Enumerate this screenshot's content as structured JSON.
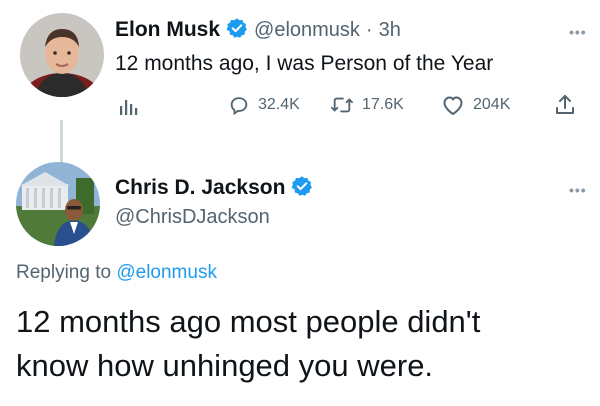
{
  "tweet1": {
    "name": "Elon Musk",
    "handle": "@elonmusk",
    "separator": "·",
    "time": "3h",
    "text": "12 months ago, I was Person of the Year",
    "stats": {
      "replies": "32.4K",
      "retweets": "17.6K",
      "likes": "204K"
    }
  },
  "tweet2": {
    "name": "Chris D. Jackson",
    "handle": "@ChrisDJackson",
    "replying_prefix": "Replying to",
    "replying_to": "@elonmusk",
    "text_line1": "12 months ago most people didn't",
    "text_line2": "know how unhinged you were."
  },
  "colors": {
    "accent": "#1d9bf0",
    "muted": "#536471",
    "text": "#0f1419"
  },
  "icons": [
    "verified-badge-icon",
    "analytics-icon",
    "reply-icon",
    "retweet-icon",
    "like-icon",
    "share-icon",
    "more-icon"
  ]
}
